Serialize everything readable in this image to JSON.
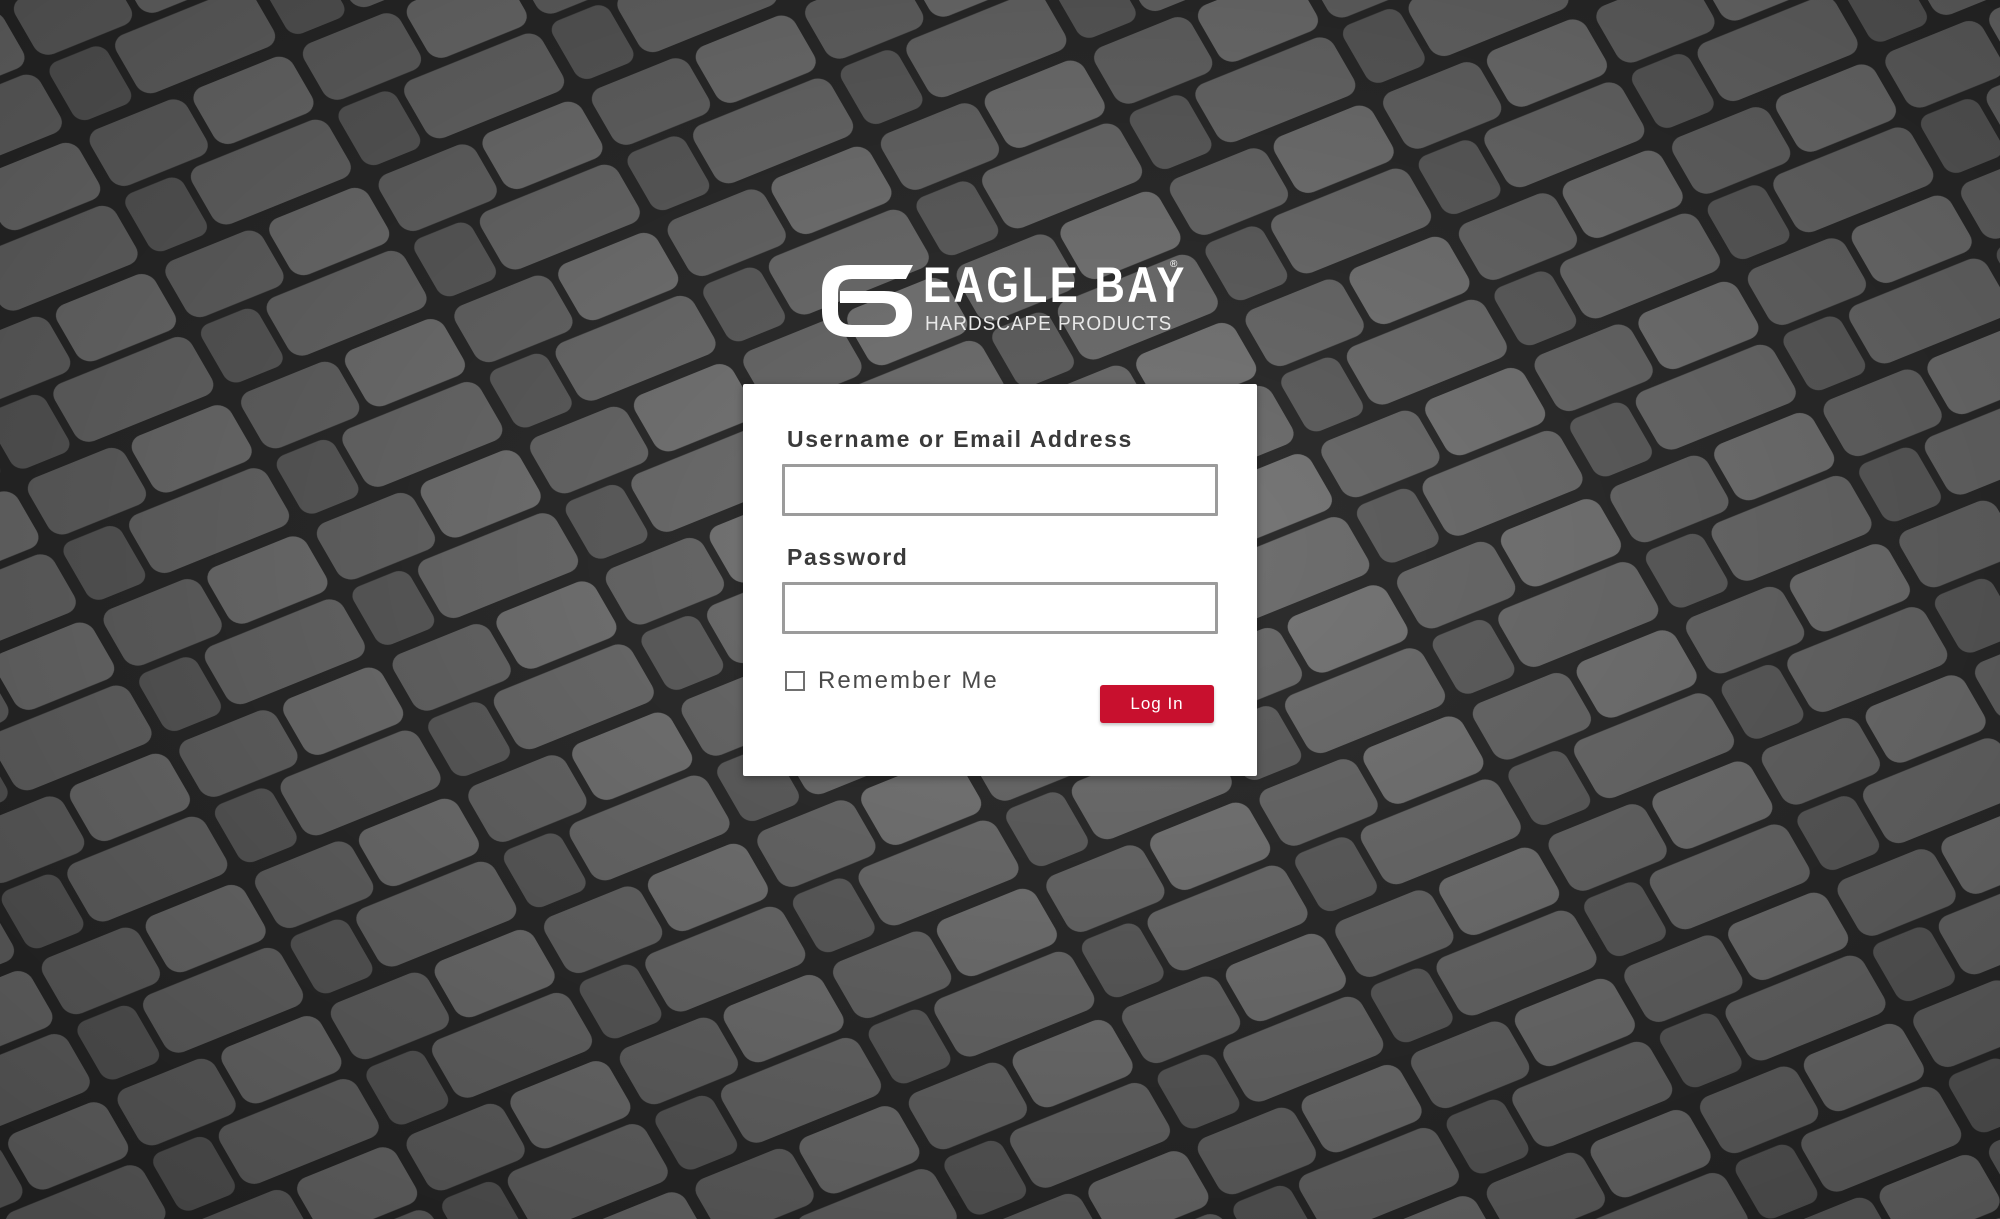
{
  "background": {
    "description_icon": "paver-stone-background-image",
    "tone": "grayscale"
  },
  "brand": {
    "name": "EAGLE BAY",
    "registered_mark": "®",
    "tagline": "HARDSCAPE PRODUCTS",
    "logo_icon": "eagle-bay-logo-mark"
  },
  "login_form": {
    "username_label": "Username or Email Address",
    "username_value": "",
    "password_label": "Password",
    "password_value": "",
    "remember_label": "Remember Me",
    "remember_checked": false,
    "submit_label": "Log In"
  },
  "colors": {
    "accent": "#c8102e",
    "card": "#ffffff",
    "input_border": "#9b9b9b"
  }
}
